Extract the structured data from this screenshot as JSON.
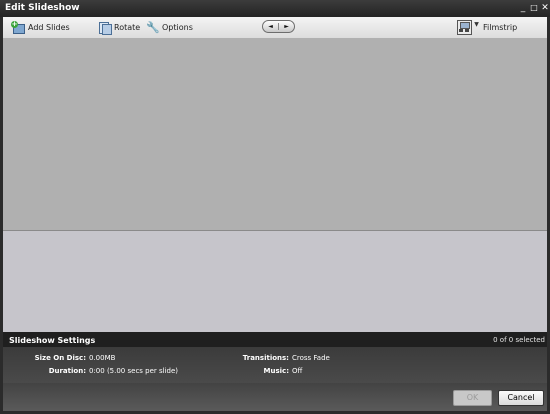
{
  "window": {
    "title": "Edit Slideshow",
    "minimize": "_",
    "maximize": "□",
    "close": "✕"
  },
  "toolbar": {
    "add_slides": "Add Slides",
    "rotate": "Rotate",
    "options": "Options",
    "prev": "◄",
    "next": "►",
    "filmstrip": "Filmstrip"
  },
  "settings": {
    "header": "Slideshow Settings",
    "selection": "0 of 0 selected",
    "size_label": "Size On Disc:",
    "size_value": "0.00MB",
    "duration_label": "Duration:",
    "duration_value": "0:00 (5.00 secs per slide)",
    "transitions_label": "Transitions:",
    "transitions_value": "Cross Fade",
    "music_label": "Music:",
    "music_value": "Off"
  },
  "buttons": {
    "ok": "OK",
    "cancel": "Cancel"
  }
}
